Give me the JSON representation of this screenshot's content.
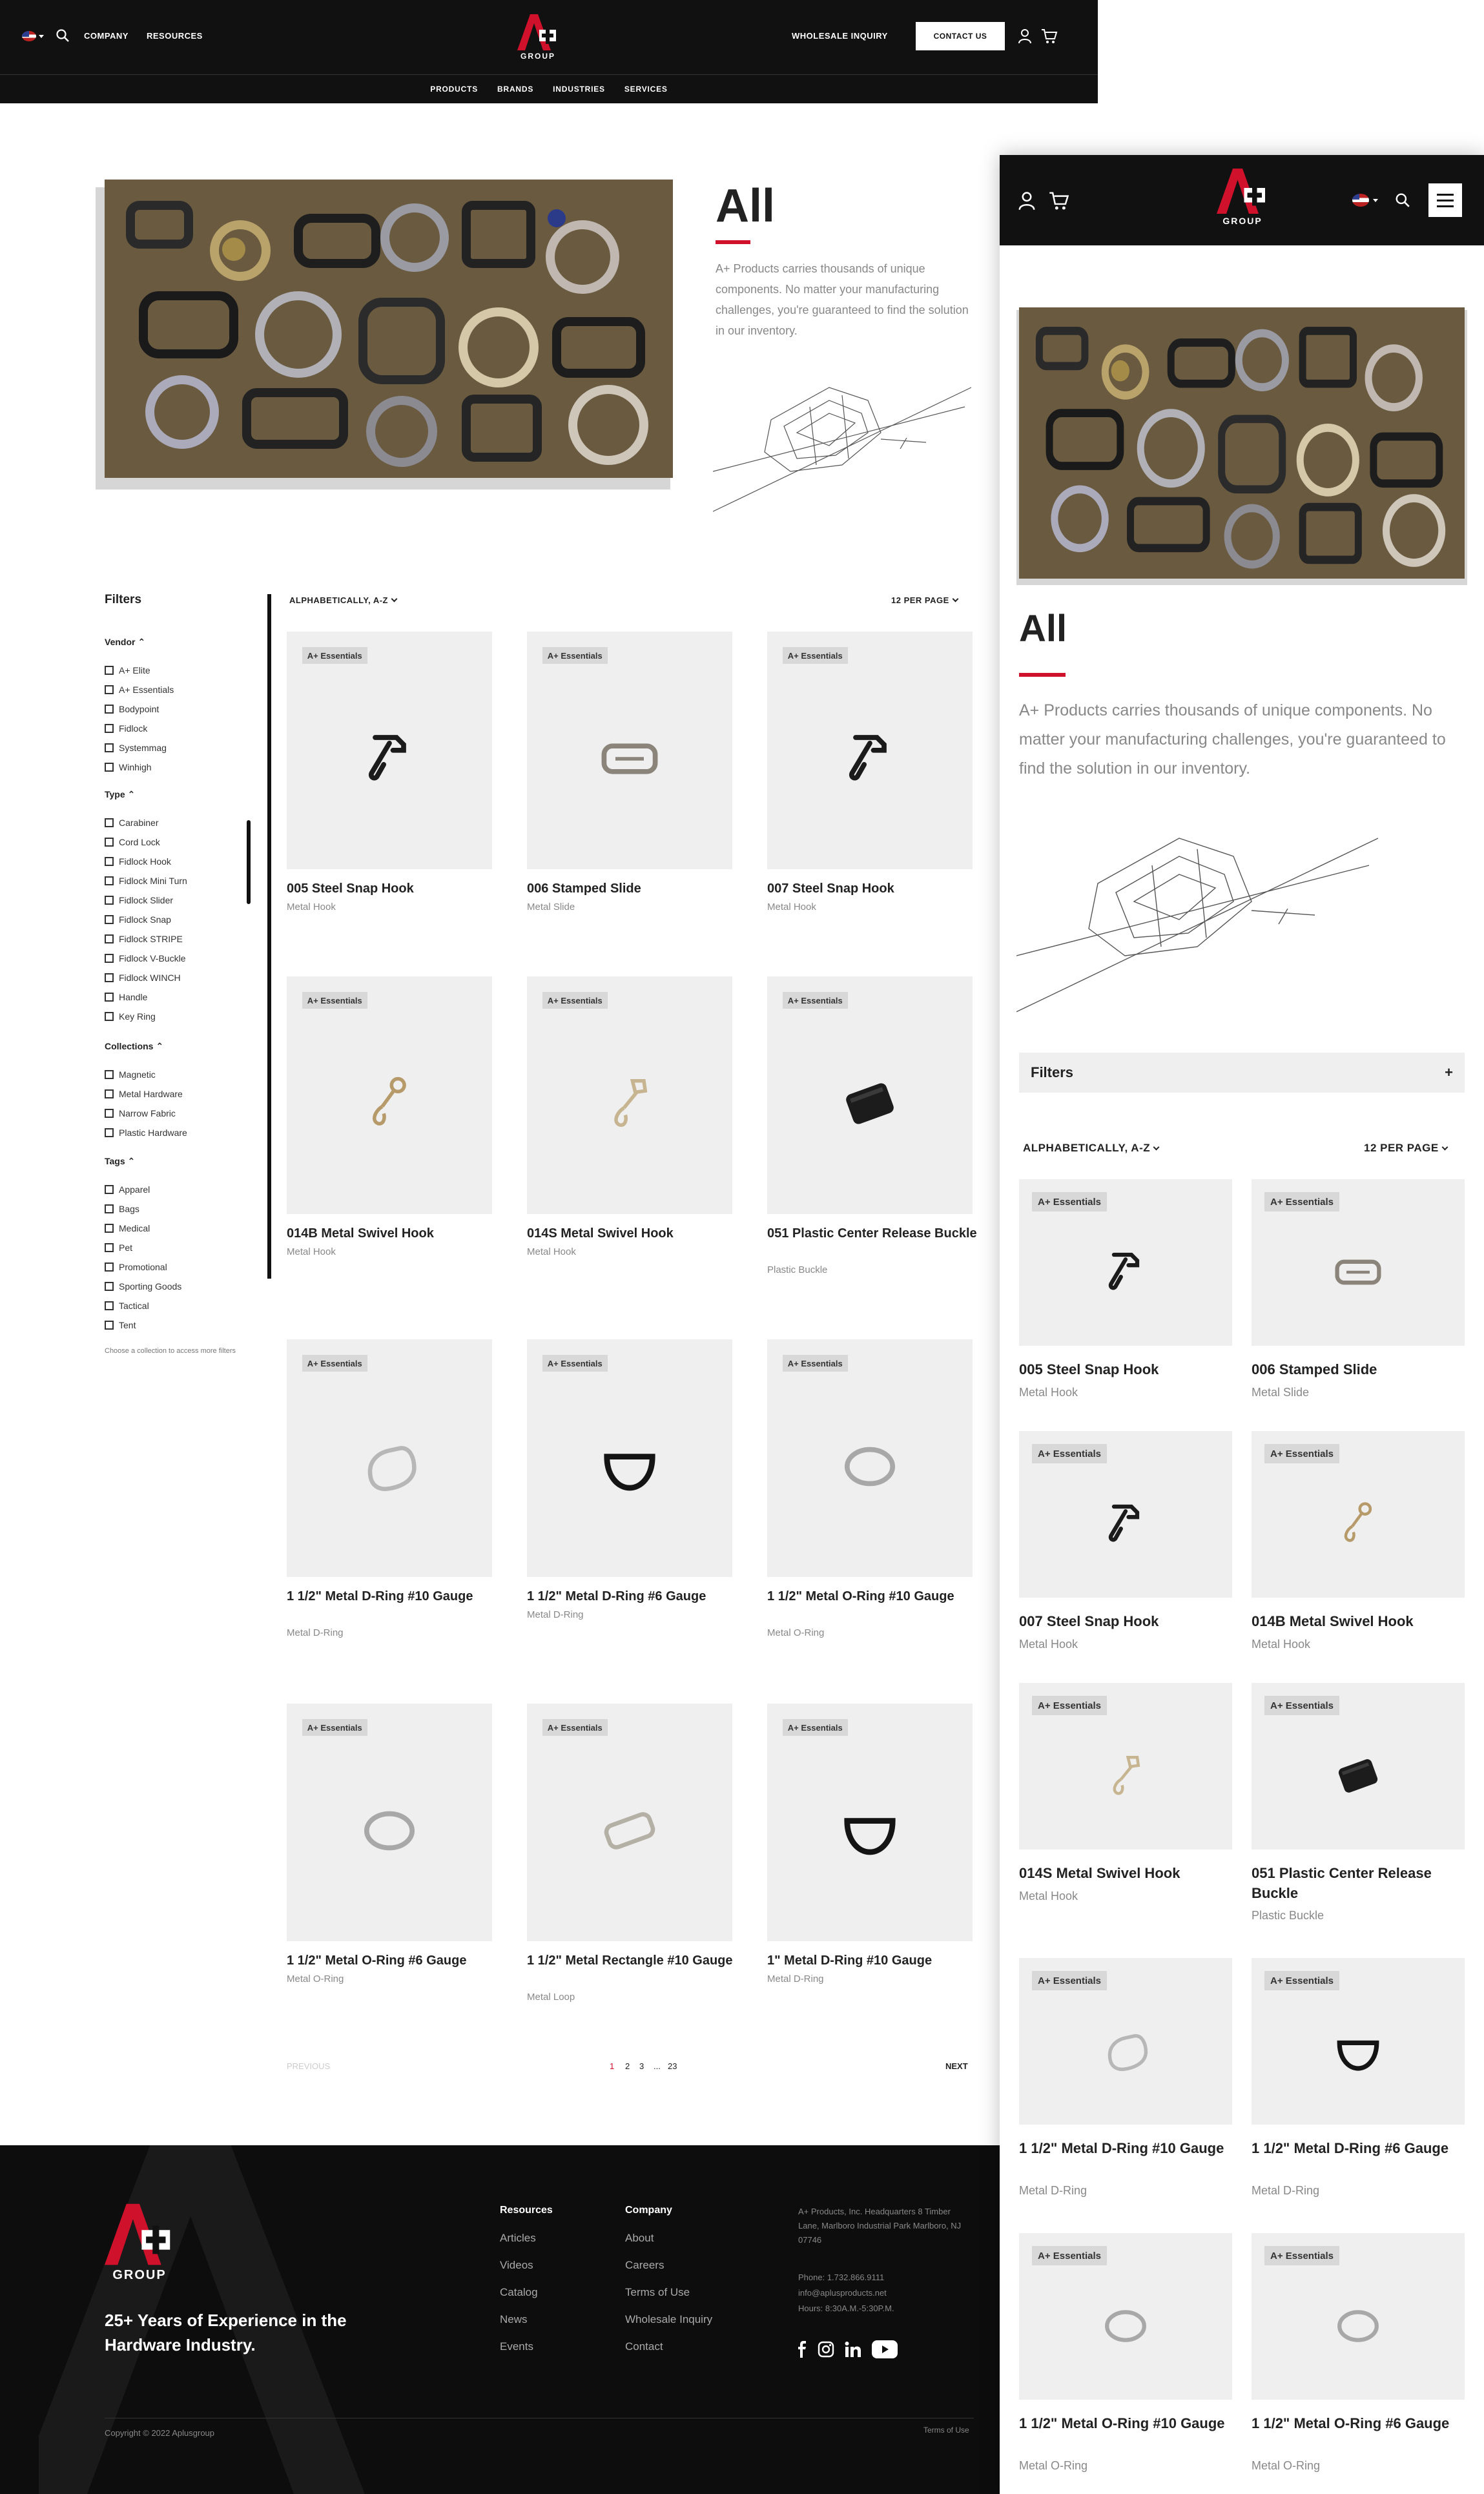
{
  "header": {
    "links": [
      "COMPANY",
      "RESOURCES"
    ],
    "logo_text": "GROUP",
    "logo_sub": "PLUS",
    "wholesale": "WHOLESALE INQUIRY",
    "contact": "CONTACT US",
    "nav": [
      "PRODUCTS",
      "BRANDS",
      "INDUSTRIES",
      "SERVICES"
    ]
  },
  "hero": {
    "title": "All",
    "description": "A+ Products carries thousands of unique components. No matter your manufacturing challenges, you're guaranteed to find the solution in our inventory."
  },
  "filters": {
    "title": "Filters",
    "vendor": {
      "label": "Vendor",
      "items": [
        "A+ Elite",
        "A+ Essentials",
        "Bodypoint",
        "Fidlock",
        "Systemmag",
        "Winhigh"
      ]
    },
    "type": {
      "label": "Type",
      "items": [
        "Carabiner",
        "Cord Lock",
        "Fidlock Hook",
        "Fidlock Mini Turn",
        "Fidlock Slider",
        "Fidlock Snap",
        "Fidlock STRIPE",
        "Fidlock V-Buckle",
        "Fidlock WINCH",
        "Handle",
        "Key Ring"
      ]
    },
    "collections": {
      "label": "Collections",
      "items": [
        "Magnetic",
        "Metal Hardware",
        "Narrow Fabric",
        "Plastic Hardware"
      ]
    },
    "tags": {
      "label": "Tags",
      "items": [
        "Apparel",
        "Bags",
        "Medical",
        "Pet",
        "Promotional",
        "Sporting Goods",
        "Tactical",
        "Tent"
      ]
    },
    "note": "Choose a collection to access more filters"
  },
  "sort": {
    "order": "ALPHABETICALLY, A-Z",
    "per_page": "12 PER PAGE"
  },
  "products": [
    {
      "badge": "A+ Essentials",
      "name": "005 Steel Snap Hook",
      "type": "Metal Hook",
      "icon": "snap-hook-dark"
    },
    {
      "badge": "A+ Essentials",
      "name": "006 Stamped Slide",
      "type": "Metal Slide",
      "icon": "slide"
    },
    {
      "badge": "A+ Essentials",
      "name": "007 Steel Snap Hook",
      "type": "Metal Hook",
      "icon": "snap-hook-dark"
    },
    {
      "badge": "A+ Essentials",
      "name": "014B Metal Swivel Hook",
      "type": "Metal Hook",
      "icon": "swivel-hook-brass"
    },
    {
      "badge": "A+ Essentials",
      "name": "014S Metal Swivel Hook",
      "type": "Metal Hook",
      "icon": "swivel-hook-silver"
    },
    {
      "badge": "A+ Essentials",
      "name": "051 Plastic Center Release Buckle",
      "type": "Plastic Buckle",
      "icon": "buckle"
    },
    {
      "badge": "A+ Essentials",
      "name": "1 1/2\" Metal D-Ring #10 Gauge",
      "type": "Metal D-Ring",
      "icon": "d-ring-silver"
    },
    {
      "badge": "A+ Essentials",
      "name": "1 1/2\" Metal D-Ring #6 Gauge",
      "type": "Metal D-Ring",
      "icon": "d-ring-black"
    },
    {
      "badge": "A+ Essentials",
      "name": "1 1/2\" Metal O-Ring #10 Gauge",
      "type": "Metal O-Ring",
      "icon": "o-ring-silver"
    },
    {
      "badge": "A+ Essentials",
      "name": "1 1/2\" Metal O-Ring #6 Gauge",
      "type": "Metal O-Ring",
      "icon": "o-ring-silver"
    },
    {
      "badge": "A+ Essentials",
      "name": "1 1/2\" Metal Rectangle #10 Gauge",
      "type": "Metal Loop",
      "icon": "rectangle"
    },
    {
      "badge": "A+ Essentials",
      "name": "1\" Metal D-Ring #10 Gauge",
      "type": "Metal D-Ring",
      "icon": "d-ring-black"
    }
  ],
  "pagination": {
    "previous": "PREVIOUS",
    "pages": [
      "1",
      "2",
      "3",
      "...",
      "23"
    ],
    "next": "NEXT"
  },
  "footer": {
    "tagline": "25+ Years of Experience in the Hardware Industry.",
    "resources_title": "Resources",
    "resources": [
      "Articles",
      "Videos",
      "Catalog",
      "News",
      "Events"
    ],
    "company_title": "Company",
    "company": [
      "About",
      "Careers",
      "Terms of Use",
      "Wholesale Inquiry",
      "Contact"
    ],
    "address": "A+ Products, Inc. Headquarters 8 Timber Lane, Marlboro Industrial Park Marlboro, NJ 07746",
    "phone": "Phone: 1.732.866.9111",
    "email": "info@aplusproducts.net",
    "hours": "Hours: 8:30A.M.-5:30P.M.",
    "copyright": "Copyright © 2022 Aplusgroup",
    "terms": "Terms of Use"
  },
  "mobile": {
    "filters_label": "Filters",
    "filters_plus": "+"
  },
  "colors": {
    "accent": "#d0112b",
    "dark": "#111111",
    "card_bg": "#efefef"
  }
}
